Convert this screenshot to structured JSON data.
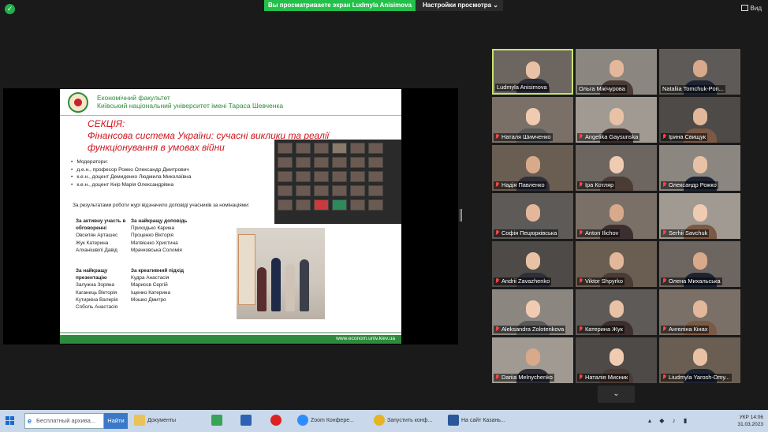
{
  "topbar": {
    "banner": "Вы просматриваете экран Ludmyla Anisimova",
    "view_options": "Настройки просмотра",
    "view_button": "Вид"
  },
  "slide": {
    "faculty": "Економічний факультет",
    "university": "Київський національний університет імені Тараса Шевченка",
    "section_title": "СЕКЦІЯ:",
    "section_subtitle": "Фінансова система України: сучасні виклики та реалії функціонування в умовах війни",
    "moderators_label": "Модератори:",
    "moderators": [
      "д.е.н., професор Рожко Олександр Дмитрович",
      "к.е.н., доцент Демиденко Людмила Миколаївна",
      "к.е.н., доцент Кнір Марія Олександрівна"
    ],
    "jury_note": "За результатами роботи журі відзначило доповіді учасників за номінаціями:",
    "nom1_title_a": "За активну участь в",
    "nom1_title_b": "обговоренні",
    "nom1_people": [
      "Овсепян Арташес",
      "Жук Катерина",
      "Алханішвілі Давід"
    ],
    "nom2_title": "За найкращу доповідь",
    "nom2_people": [
      "Приходько Карина",
      "Проценко Вікторія",
      "Матвієнко Христина",
      "Мрачковська Соломія"
    ],
    "nom3_title_a": "За найкращу",
    "nom3_title_b": "презентацію",
    "nom3_people": [
      "Залужна Зоряна",
      "Каганець Вікторія",
      "Кутиркіна Валерія",
      "Соболь Анастасія"
    ],
    "nom4_title": "За креативний підхід",
    "nom4_people": [
      "Кудра Анастасія",
      "Марисєв Сергій",
      "Іщенко Катерина",
      "Мошко Дмитро"
    ],
    "website": "www.econom.univ.kiev.ua"
  },
  "participants": [
    {
      "name": "Ludmyla Anisimova",
      "muted": false,
      "active": true
    },
    {
      "name": "Ольга Мікічурова",
      "muted": false,
      "active": false
    },
    {
      "name": "Nataliia Tomchuk-Pon...",
      "muted": false,
      "active": false
    },
    {
      "name": "Наталя Шимченко",
      "muted": true,
      "active": false
    },
    {
      "name": "Angelika Gaysunska",
      "muted": true,
      "active": false
    },
    {
      "name": "Ірина Свищук",
      "muted": true,
      "active": false
    },
    {
      "name": "Надія Павленко",
      "muted": true,
      "active": false
    },
    {
      "name": "Іра Котляр",
      "muted": true,
      "active": false
    },
    {
      "name": "Олександр Рожко",
      "muted": true,
      "active": false
    },
    {
      "name": "Софія Пецюрківська",
      "muted": true,
      "active": false
    },
    {
      "name": "Anton Ilichov",
      "muted": true,
      "active": false
    },
    {
      "name": "Serhii Savchuk",
      "muted": true,
      "active": false
    },
    {
      "name": "Andrii Zavazhenko",
      "muted": true,
      "active": false
    },
    {
      "name": "Viktor Shpyrko",
      "muted": true,
      "active": false
    },
    {
      "name": "Олена Михальська",
      "muted": true,
      "active": false
    },
    {
      "name": "Aleksandra Zolotenkova",
      "muted": true,
      "active": false
    },
    {
      "name": "Катерина Жук",
      "muted": true,
      "active": false
    },
    {
      "name": "Ангеліна Кінах",
      "muted": true,
      "active": false
    },
    {
      "name": "Dariia Melnychenko",
      "muted": true,
      "active": false
    },
    {
      "name": "Наталія Мисник",
      "muted": true,
      "active": false
    },
    {
      "name": "Liudmyla Yarosh-Dmy...",
      "muted": true,
      "active": false
    }
  ],
  "taskbar": {
    "search_value": "Бесплатный архива...",
    "find_button": "Найти",
    "items": [
      "Документы",
      "",
      "",
      "",
      "Zoom Конфере...",
      "Запустить конф...",
      "На сайт Казань..."
    ],
    "time": "14:06",
    "date": "31.03.2023",
    "lang": "УКР"
  },
  "colors": {
    "banner_green": "#23c04a",
    "active_border": "#c6e36a",
    "slide_red": "#d0161e",
    "slide_green": "#2e8b3d",
    "muted_mic": "#ff4242"
  }
}
